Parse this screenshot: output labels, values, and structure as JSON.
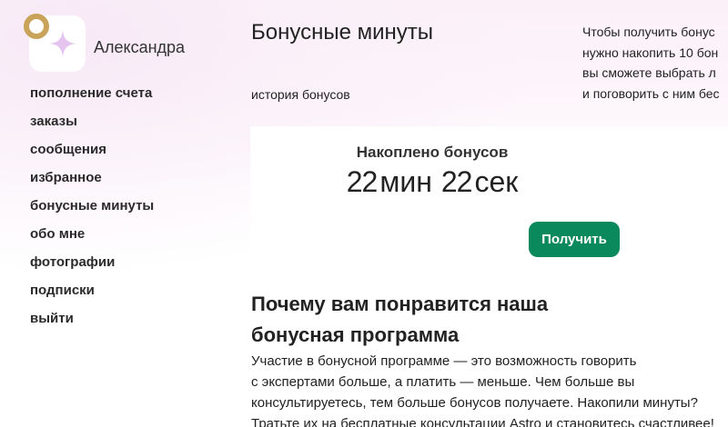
{
  "colors": {
    "accent_button": "#0a8a5c",
    "background_tint": "#fbf0f8",
    "logo_ring": "#c9a35a",
    "logo_star": "#e6c4f0"
  },
  "profile": {
    "logo_icon": "star-logo-icon",
    "name": "Александра"
  },
  "sidebar": {
    "items": [
      {
        "label": "пополнение счета"
      },
      {
        "label": "заказы"
      },
      {
        "label": "сообщения"
      },
      {
        "label": "избранное"
      },
      {
        "label": "бонусные минуты"
      },
      {
        "label": "обо мне"
      },
      {
        "label": "фотографии"
      },
      {
        "label": "подписки"
      },
      {
        "label": "выйти"
      }
    ]
  },
  "main": {
    "title": "Бонусные минуты",
    "history_link": "история бонусов",
    "info_lines": [
      "Чтобы получить бонус",
      "нужно накопить 10 бон",
      "вы сможете выбрать л",
      "и поговорить с ним бес"
    ],
    "accumulated": {
      "label": "Накоплено бонусов",
      "minutes": "22",
      "minutes_unit": "мин",
      "seconds": "22",
      "seconds_unit": "сек"
    },
    "get_button": "Получить",
    "why": {
      "title_lines": [
        "Почему вам понравится наша",
        "бонусная программа"
      ],
      "text_lines": [
        "Участие в бонусной программе — это возможность говорить",
        "с экспертами больше, а платить — меньше. Чем больше вы",
        "консультируетесь, тем больше бонусов получаете. Накопили минуты?",
        "Тратьте их на бесплатные консультации Astro и становитесь счастливее!"
      ]
    }
  }
}
